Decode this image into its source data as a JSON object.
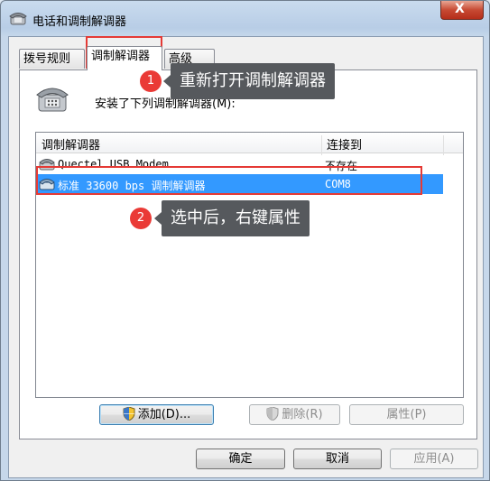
{
  "window": {
    "title": "电话和调制解调器",
    "close_symbol": "X"
  },
  "tabs": [
    {
      "label": "拨号规则"
    },
    {
      "label": "调制解调器"
    },
    {
      "label": "高级"
    }
  ],
  "panel": {
    "installed_label": "安装了下列调制解调器(M):"
  },
  "list": {
    "columns": [
      "调制解调器",
      "连接到"
    ],
    "rows": [
      {
        "name": "Quectel USB Modem",
        "port": "不存在"
      },
      {
        "name": "标准 33600 bps 调制解调器",
        "port": "COM8"
      }
    ]
  },
  "panel_buttons": {
    "add": "添加(D)...",
    "delete": "删除(R)",
    "properties": "属性(P)"
  },
  "dialog_buttons": {
    "ok": "确定",
    "cancel": "取消",
    "apply": "应用(A)"
  },
  "annotations": [
    {
      "number": "1",
      "text": "重新打开调制解调器"
    },
    {
      "number": "2",
      "text": "选中后，右键属性"
    }
  ],
  "colors": {
    "selection": "#3399ff",
    "annotation_red": "#e53a35",
    "callout_bg": "#56595d"
  }
}
